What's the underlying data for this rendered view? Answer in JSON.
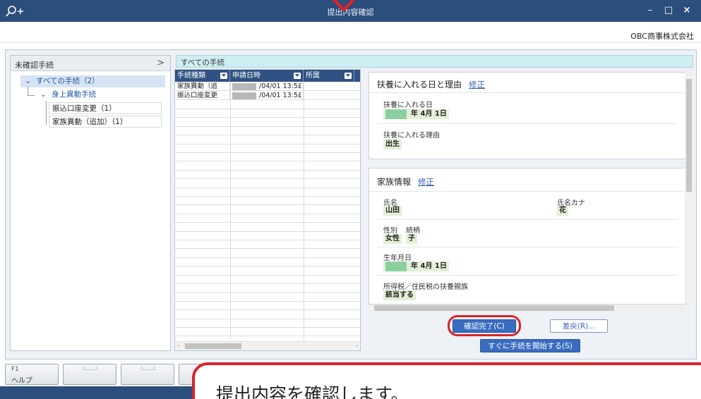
{
  "window": {
    "title": "提出内容確認",
    "company": "OBC商事株式会社",
    "minimize": "–",
    "maximize": "□",
    "close": "×"
  },
  "left_panel": {
    "header": "未確認手続",
    "expand_symbol": ">",
    "tree": {
      "root": "すべての手続（2）",
      "group": "身上異動手続",
      "items": [
        "振込口座変更（1）",
        "家族異動（追加）（1）"
      ]
    }
  },
  "list": {
    "section_title": "すべての手続",
    "columns": [
      "手続種類",
      "申請日時",
      "所属"
    ],
    "rows": [
      {
        "type": "家族異動（追",
        "date": "/04/01 13:5£"
      },
      {
        "type": "振込口座変更",
        "date": "/04/01 13:5£"
      }
    ]
  },
  "detail": {
    "card1": {
      "title": "扶養に入れる日と理由",
      "edit_link": "修正",
      "fields": [
        {
          "label": "扶養に入れる日",
          "value": "年 4月 1日"
        },
        {
          "label": "扶養に入れる理由",
          "value": "出生"
        }
      ]
    },
    "card2": {
      "title": "家族情報",
      "edit_link": "修正",
      "name_label": "氏名",
      "name_value": "山田",
      "kana_label": "氏名カナ",
      "kana_value": "花",
      "gender_label": "性別",
      "gender_value": "女性",
      "relation_label": "続柄",
      "relation_value": "子",
      "birth_label": "生年月日",
      "birth_value": "年 4月 1日",
      "tax_label": "所得税／住民税の扶養親族",
      "tax_value": "該当する"
    }
  },
  "actions": {
    "confirm": "確認完了(C)",
    "return": "差戻(R)...",
    "start": "すぐに手続を開始する(S)"
  },
  "fkeys": [
    {
      "key": "F1",
      "label": "ヘルプ"
    }
  ],
  "callout": "提出内容を確認します。",
  "colors": {
    "titlebar": "#2b4e7c",
    "grid_header": "#2f5283",
    "accent_red": "#d8232a",
    "primary_button": "#3a6cc0",
    "value_highlight": "#e2efd4"
  }
}
